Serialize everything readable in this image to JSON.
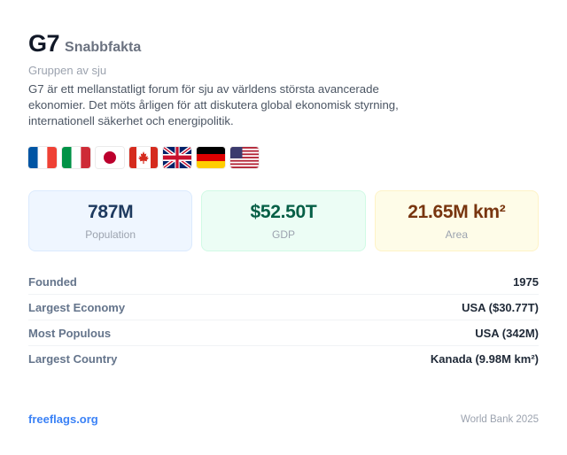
{
  "header": {
    "title": "G7",
    "title_suffix": "Snabbfakta",
    "subtitle": "Gruppen av sju",
    "description": "G7 är ett mellanstatligt forum för sju av världens största avancerade ekonomier. Det möts årligen för att diskutera global ekonomisk styrning, internationell säkerhet och energipolitik."
  },
  "flags": [
    {
      "icon": "france-flag-icon"
    },
    {
      "icon": "italy-flag-icon"
    },
    {
      "icon": "japan-flag-icon"
    },
    {
      "icon": "canada-flag-icon"
    },
    {
      "icon": "uk-flag-icon"
    },
    {
      "icon": "germany-flag-icon"
    },
    {
      "icon": "usa-flag-icon"
    }
  ],
  "stats": {
    "population": {
      "value": "787M",
      "label": "Population",
      "color": "#1e3a5f"
    },
    "gdp": {
      "value": "$52.50T",
      "label": "GDP",
      "color": "#065f46"
    },
    "area": {
      "value": "21.65M km²",
      "label": "Area",
      "color": "#78350f"
    }
  },
  "facts": [
    {
      "label": "Founded",
      "value": "1975"
    },
    {
      "label": "Largest Economy",
      "value": "USA ($30.77T)"
    },
    {
      "label": "Most Populous",
      "value": "USA (342M)"
    },
    {
      "label": "Largest Country",
      "value": "Kanada (9.98M km²)"
    }
  ],
  "footer": {
    "link": "freeflags.org",
    "source": "World Bank 2025"
  }
}
